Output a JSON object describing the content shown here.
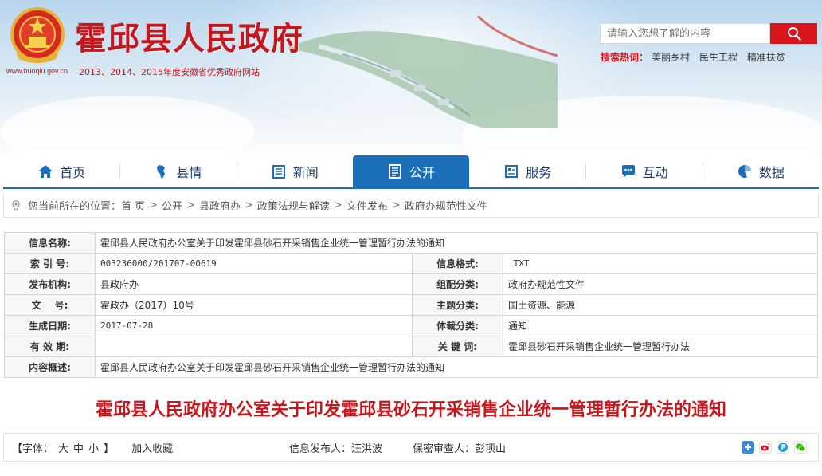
{
  "header": {
    "site_title": "霍邱县人民政府",
    "site_url": "www.huoqiu.gov.cn",
    "subtitle": "2013、2014、2015年度安徽省优秀政府网站",
    "search_placeholder": "请输入您想了解的内容",
    "hot_label": "搜索热词：",
    "hot_words": [
      "美丽乡村",
      "民生工程",
      "精准扶贫"
    ]
  },
  "nav": {
    "items": [
      {
        "label": "首页",
        "icon": "home-icon"
      },
      {
        "label": "县情",
        "icon": "map-icon"
      },
      {
        "label": "新闻",
        "icon": "news-icon"
      },
      {
        "label": "公开",
        "icon": "document-icon",
        "active": true
      },
      {
        "label": "服务",
        "icon": "service-icon"
      },
      {
        "label": "互动",
        "icon": "chat-icon"
      },
      {
        "label": "数据",
        "icon": "chart-icon"
      }
    ]
  },
  "breadcrumb": {
    "prefix": "您当前所在的位置：",
    "items": [
      "首 页",
      "公开",
      "县政府办",
      "政策法规与解读",
      "文件发布",
      "政府办规范性文件"
    ],
    "separator": ">"
  },
  "info": {
    "name_label": "信息名称:",
    "name_value": "霍邱县人民政府办公室关于印发霍邱县砂石开采销售企业统一管理暂行办法的通知",
    "index_label": "索 引 号:",
    "index_value": "003236000/201707-00619",
    "format_label": "信息格式:",
    "format_value": ".TXT",
    "org_label": "发布机构:",
    "org_value": "县政府办",
    "category_label": "组配分类:",
    "category_value": "政府办规范性文件",
    "docno_label": "文    号:",
    "docno_value": "霍政办（2017）10号",
    "topic_label": "主题分类:",
    "topic_value": "国土资源、能源",
    "date_label": "生成日期:",
    "date_value": "2017-07-28",
    "genre_label": "体裁分类:",
    "genre_value": "通知",
    "validity_label": "有 效 期:",
    "validity_value": "",
    "keywords_label": "关 键 词:",
    "keywords_value": "霍邱县砂石开采销售企业统一管理暂行办法",
    "summary_label": "内容概述:",
    "summary_value": "霍邱县人民政府办公室关于印发霍邱县砂石开采销售企业统一管理暂行办法的通知"
  },
  "article": {
    "title": "霍邱县人民政府办公室关于印发霍邱县砂石开采销售企业统一管理暂行办法的通知"
  },
  "toolbar": {
    "font_label": "【字体：",
    "font_large": "大",
    "font_medium": "中",
    "font_small": "小",
    "font_close": "】",
    "favorite": "加入收藏",
    "publisher": "信息发布人：汪洪波",
    "reviewer": "保密审查人：彭项山"
  },
  "colors": {
    "brand_red": "#c8161d",
    "nav_blue": "#1a6fb8"
  }
}
